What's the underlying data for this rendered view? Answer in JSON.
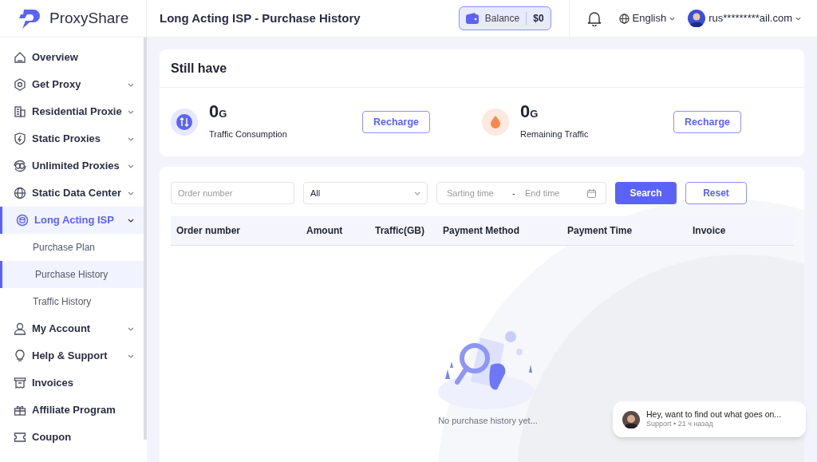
{
  "header": {
    "brand": "ProxyShare",
    "page_title": "Long Acting ISP - Purchase History",
    "balance_label": "Balance",
    "balance_value": "$0",
    "language": "English",
    "account": "rus*********ail.com"
  },
  "sidebar": {
    "items": [
      {
        "label": "Overview",
        "expandable": false,
        "selected": false
      },
      {
        "label": "Get Proxy",
        "expandable": true,
        "selected": false
      },
      {
        "label": "Residential Proxie",
        "expandable": true,
        "selected": false
      },
      {
        "label": "Static Proxies",
        "expandable": true,
        "selected": false
      },
      {
        "label": "Unlimited Proxies",
        "expandable": true,
        "selected": false
      },
      {
        "label": "Static Data Center",
        "expandable": true,
        "selected": false
      },
      {
        "label": "Long Acting ISP",
        "expandable": true,
        "selected": true,
        "children": [
          {
            "label": "Purchase Plan",
            "selected": false
          },
          {
            "label": "Purchase History",
            "selected": true
          },
          {
            "label": "Traffic History",
            "selected": false
          }
        ]
      },
      {
        "label": "My Account",
        "expandable": true,
        "selected": false
      },
      {
        "label": "Help & Support",
        "expandable": true,
        "selected": false
      },
      {
        "label": "Invoices",
        "expandable": false,
        "selected": false
      },
      {
        "label": "Affiliate Program",
        "expandable": false,
        "selected": false
      },
      {
        "label": "Coupon",
        "expandable": false,
        "selected": false
      }
    ]
  },
  "summary": {
    "title": "Still have",
    "stats": [
      {
        "kind": "consumption",
        "value": "0",
        "unit": "G",
        "label": "Traffic Consumption",
        "button": "Recharge"
      },
      {
        "kind": "remaining",
        "value": "0",
        "unit": "G",
        "label": "Remaining Traffic",
        "button": "Recharge"
      }
    ]
  },
  "filters": {
    "order_placeholder": "Order number",
    "type_value": "All",
    "start_placeholder": "Sarting time",
    "separator": "-",
    "end_placeholder": "End time",
    "search_button": "Search",
    "reset_button": "Reset"
  },
  "table": {
    "columns": [
      "Order number",
      "Amount",
      "Traffic(GB)",
      "Payment Method",
      "Payment Time",
      "Invoice"
    ],
    "empty_text": "No purchase history yet..."
  },
  "chat_popup": {
    "message": "Hey, want to find out what goes on...",
    "sender": "Support",
    "separator": "•",
    "time": "21 ч назад"
  }
}
